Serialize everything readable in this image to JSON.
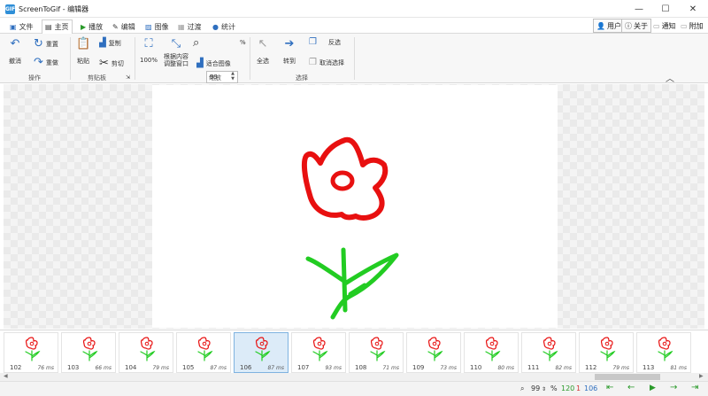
{
  "window": {
    "title": "ScreenToGif - 编辑器",
    "icon_text": "GIF"
  },
  "tabs": [
    {
      "label": "文件",
      "icon": "save-icon"
    },
    {
      "label": "主页",
      "icon": "home-icon"
    },
    {
      "label": "播放",
      "icon": "play-icon"
    },
    {
      "label": "编辑",
      "icon": "pencil-icon"
    },
    {
      "label": "图像",
      "icon": "image-icon"
    },
    {
      "label": "过渡",
      "icon": "transition-icon"
    },
    {
      "label": "统计",
      "icon": "info-icon"
    }
  ],
  "right_buttons": {
    "user": "用户",
    "about": "关于",
    "notify": "通知",
    "attach": "附加"
  },
  "ribbon": {
    "groups": {
      "actions": "操作",
      "clipboard": "剪贴板",
      "zoom": "缩放",
      "select": "选择"
    },
    "undo": "撤消",
    "redo": "重置",
    "reset": "重做",
    "paste": "粘贴",
    "copy": "复制",
    "cut": "剪切",
    "zoom100": "100%",
    "fit_content": "根据内容",
    "adjust_window": "调整窗口",
    "fit_image": "适合图像",
    "zoom_value": "99",
    "zoom_unit": "%",
    "select_all": "全选",
    "goto": "转到",
    "inverse": "反选",
    "deselect": "取消选择"
  },
  "frames": [
    {
      "num": "102",
      "ms": "76 ms"
    },
    {
      "num": "103",
      "ms": "66 ms"
    },
    {
      "num": "104",
      "ms": "79 ms"
    },
    {
      "num": "105",
      "ms": "87 ms"
    },
    {
      "num": "106",
      "ms": "87 ms",
      "selected": true
    },
    {
      "num": "107",
      "ms": "93 ms"
    },
    {
      "num": "108",
      "ms": "71 ms"
    },
    {
      "num": "109",
      "ms": "73 ms"
    },
    {
      "num": "110",
      "ms": "80 ms"
    },
    {
      "num": "111",
      "ms": "82 ms"
    },
    {
      "num": "112",
      "ms": "79 ms"
    },
    {
      "num": "113",
      "ms": "81 ms"
    }
  ],
  "status": {
    "zoom": "99",
    "zoom_unit": "%",
    "frame_count": "120",
    "selected_count": "1",
    "current_frame": "106"
  },
  "colors": {
    "accent": "#2f6fbf",
    "flower_red": "#e81010",
    "stem_green": "#22cc22",
    "count_green": "#2a9a2a",
    "count_red": "#d33333"
  }
}
